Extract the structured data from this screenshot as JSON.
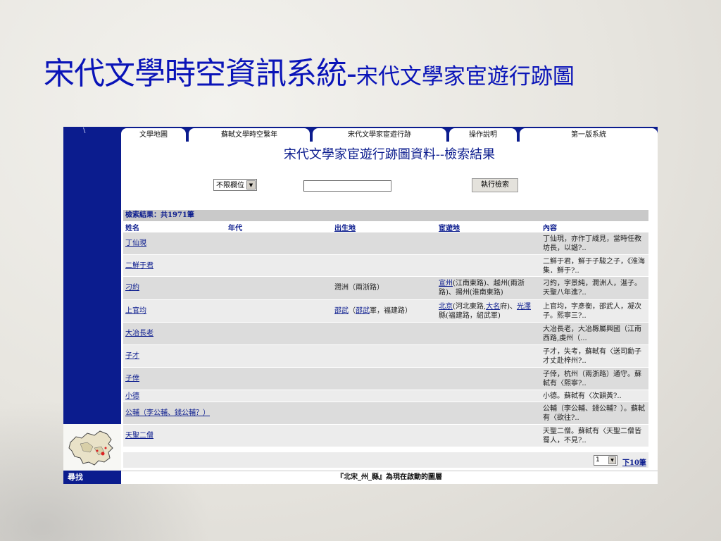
{
  "slide": {
    "title_main": "宋代文學時空資訊系統-",
    "title_sub": "宋代文學家宦遊行跡圖"
  },
  "nav": {
    "tabs": [
      {
        "label": "文學地圖"
      },
      {
        "label": "蘇軾文學時空繫年"
      },
      {
        "label": "宋代文學家宦遊行跡"
      },
      {
        "label": "操作說明"
      },
      {
        "label": "第一版系統"
      }
    ]
  },
  "page": {
    "heading": "宋代文學家宦遊行跡圖資料--檢索結果"
  },
  "search": {
    "field_selected": "不限欄位",
    "query_value": "",
    "submit_label": "執行檢索"
  },
  "results": {
    "count_label": "檢索結果：共1971筆",
    "columns": {
      "name": "姓名",
      "era": "年代",
      "birthplace": "出生地",
      "office_places": "宦遊地",
      "content": "內容"
    },
    "rows": [
      {
        "name": "丁仙現",
        "birth": "",
        "office_a": "",
        "office_b": "",
        "office_c": "",
        "office_d": "",
        "office_e": "",
        "desc": "丁仙現，亦作丁綫見，當時任教坊長，以諧?.."
      },
      {
        "name": "二鮮于君",
        "birth": "",
        "office_a": "",
        "office_b": "",
        "office_c": "",
        "office_d": "",
        "office_e": "",
        "desc": "二鮮于君，鮮于子駿之子，《淮海集．鮮于?.."
      },
      {
        "name": "刁約",
        "birth": "潤洲（兩浙路）",
        "office_a": "宣州",
        "office_b": "(江南東路)、越州(兩浙路)、揚州(淮南東路)",
        "office_c": "",
        "office_d": "",
        "office_e": "",
        "desc": "刁約，字景純，潤洲人，湛子。天聖八年進?.."
      },
      {
        "name": "上官均",
        "birth_link1": "邵武",
        "birth_mid": "（",
        "birth_link2": "邵武",
        "birth_tail": "軍，福建路）",
        "office_a": "北京",
        "office_b": "(河北東路,",
        "office_c": "大名",
        "office_d": "府)、",
        "office_e": "光澤",
        "office_f": "縣(福建路，紹武軍)",
        "desc": "上官均，字彥衡，邵武人，凝次子。熙寧三?.."
      },
      {
        "name": "大冶長老",
        "birth": "",
        "desc": "大冶長老，大冶縣屬興國（江南西路,虔州（..."
      },
      {
        "name": "子才",
        "birth": "",
        "desc": "子才，失考，蘇軾有〈送司勳子才丈赴梓州?.."
      },
      {
        "name": "子倖",
        "birth": "",
        "desc": "子倖，杭州（兩浙路）通守。蘇軾有〈熙寧?.."
      },
      {
        "name": "小德",
        "birth": "",
        "desc": "小德。蘇軾有〈次韻黃?.."
      },
      {
        "name": "公輔（李公輔、錢公輔？）",
        "birth": "",
        "desc": "公輔（李公輔、錢公輔？）。蘇軾有〈欲往?.."
      },
      {
        "name": "天聖二僧",
        "birth": "",
        "desc": "天聖二僧。蘇軾有〈天聖二僧皆蜀人，不見?.."
      }
    ]
  },
  "pager": {
    "page_value": "1",
    "next_label": "下10筆"
  },
  "sidebar": {
    "find_label": "尋找",
    "tick": "\\"
  },
  "footer_note": "『北宋_州_縣』為現在啟動的圖層",
  "colors": {
    "title_blue": "#0a14b8",
    "nav_blue": "#0b1c8e",
    "row_dark": "#dcdcdc",
    "row_light": "#ececec"
  },
  "icons": [
    "china-map-icon",
    "dropdown-arrow-icon"
  ]
}
